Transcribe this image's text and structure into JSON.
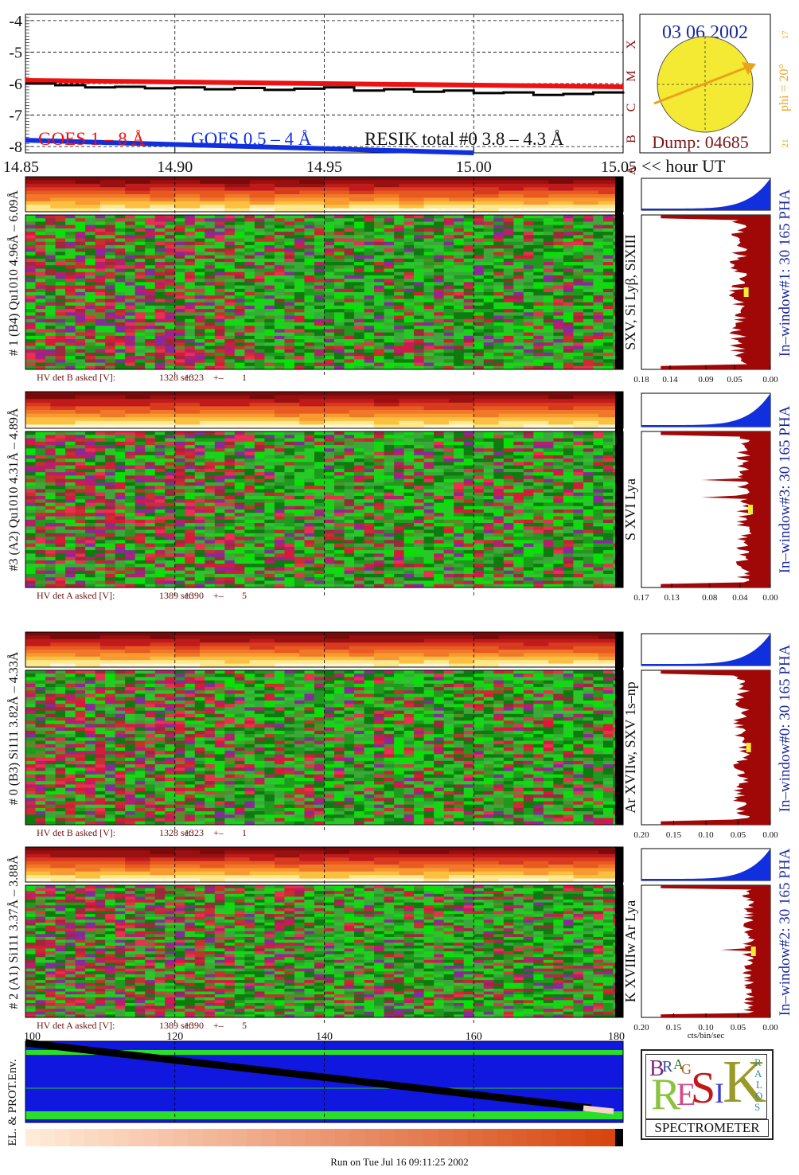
{
  "time_axis": {
    "ticks": [
      "14.85",
      "14.90",
      "14.95",
      "15.00",
      "15.05"
    ],
    "unit_label": "<< hour UT"
  },
  "goes": {
    "y_ticks": [
      "-4",
      "-5",
      "-6",
      "-7",
      "-8"
    ],
    "class_letters": [
      "X",
      "M",
      "C",
      "B",
      "A"
    ],
    "legend_goes_long": "GOES 1 – 8 Å",
    "legend_goes_short": "GOES 0.5 – 4 Å",
    "legend_resik": "RESIK total #0  3.8 – 4.3 Å",
    "colors": {
      "goes_long": "#ee1111",
      "goes_short": "#1030e0",
      "resik": "#000000"
    }
  },
  "sun": {
    "date": "03 06 2002",
    "phi_label": "phi = 20°",
    "tick_top": "17",
    "tick_bottom": "21",
    "dump": "Dump: 04685"
  },
  "panels": [
    {
      "left_label": "# 1 (B4) Qu1010 4.96Å – 6.09Å",
      "line_label": "SXV, Si Lyβ, SiXIII",
      "window_label": "In–window#1:   30 165 PHA",
      "hv": [
        "HV det B asked [V]:",
        "1328 set:",
        "1323",
        "+–",
        "1"
      ],
      "x_ticks": [
        "0.18",
        "0.14",
        "0.09",
        "0.05",
        "0.00"
      ]
    },
    {
      "left_label": "#3 (A2) Qu1010  4.31Å – 4.89Å",
      "line_label": "S XVI Lya",
      "window_label": "In–window#3:   30 165 PHA",
      "hv": [
        "HV det A asked [V]:",
        "1389 set:",
        "1390",
        "+–",
        "5"
      ],
      "x_ticks": [
        "0.17",
        "0.13",
        "0.08",
        "0.04",
        "0.00"
      ]
    },
    {
      "left_label": "# 0 (B3) Si111  3.82Å – 4.33Å",
      "line_label": "Ar XVIIw, SXV 1s–np",
      "window_label": "In–window#0:   30 165 PHA",
      "hv": [
        "HV det B asked [V]:",
        "1328 set:",
        "1323",
        "+–",
        "1"
      ],
      "x_ticks": [
        "0.20",
        "0.15",
        "0.10",
        "0.05",
        "0.00"
      ]
    },
    {
      "left_label": "# 2 (A1) Si111  3.37Å – 3.88Å",
      "line_label": "K XVIIIw  Ar Lya",
      "window_label": "In–window#2:   30 165 PHA",
      "hv": [
        "HV det A asked [V]:",
        "1389 set:",
        "1390",
        "+–",
        "5"
      ],
      "x_ticks": [
        "0.20",
        "0.15",
        "0.10",
        "0.05",
        "0.00"
      ]
    }
  ],
  "spectrum_xlabel": "cts/bin/sec",
  "env": {
    "label": "EL. & PROT.Env.",
    "ticks": [
      "100",
      "120",
      "140",
      "160",
      "180"
    ]
  },
  "logo": {
    "word": "SPECTROMETER",
    "letters": [
      "B",
      "R",
      "A",
      "G",
      "R",
      "E",
      "S",
      "I",
      "K",
      "S",
      "O",
      "L",
      "A",
      "R"
    ]
  },
  "footer": "Run on Tue Jul 16 09:11:25 2002",
  "chart_data": [
    {
      "type": "line",
      "title": "",
      "x_range": [
        14.85,
        15.05
      ],
      "ylim": [
        -8.2,
        -3.8
      ],
      "series": [
        {
          "name": "GOES 1 – 8 Å",
          "x": [
            14.85,
            15.05
          ],
          "values": [
            -5.9,
            -6.1
          ]
        },
        {
          "name": "GOES 0.5 – 4 Å",
          "x": [
            14.85,
            15.0
          ],
          "values": [
            -7.8,
            -8.2
          ]
        },
        {
          "name": "RESIK total #0  3.8 – 4.3 Å",
          "x": [
            14.85,
            14.86,
            14.87,
            14.88,
            14.89,
            14.9,
            14.91,
            14.92,
            14.93,
            14.94,
            14.95,
            14.96,
            14.97,
            14.98,
            14.99,
            15.0,
            15.01,
            15.02,
            15.03,
            15.04,
            15.05
          ],
          "values": [
            -6.0,
            -6.05,
            -6.12,
            -6.1,
            -6.15,
            -6.12,
            -6.18,
            -6.14,
            -6.2,
            -6.16,
            -6.12,
            -6.22,
            -6.18,
            -6.26,
            -6.22,
            -6.3,
            -6.28,
            -6.36,
            -6.33,
            -6.28,
            -6.25
          ]
        }
      ]
    },
    {
      "type": "area",
      "name": "PHA #1",
      "xlim": [
        0.18,
        0.0
      ],
      "plateau": 0.045
    },
    {
      "type": "area",
      "name": "PHA #3",
      "xlim": [
        0.17,
        0.0
      ],
      "plateau": 0.035
    },
    {
      "type": "area",
      "name": "PHA #0",
      "xlim": [
        0.2,
        0.0
      ],
      "plateau": 0.045
    },
    {
      "type": "area",
      "name": "PHA #2",
      "xlim": [
        0.2,
        0.0
      ],
      "plateau": 0.035
    }
  ]
}
